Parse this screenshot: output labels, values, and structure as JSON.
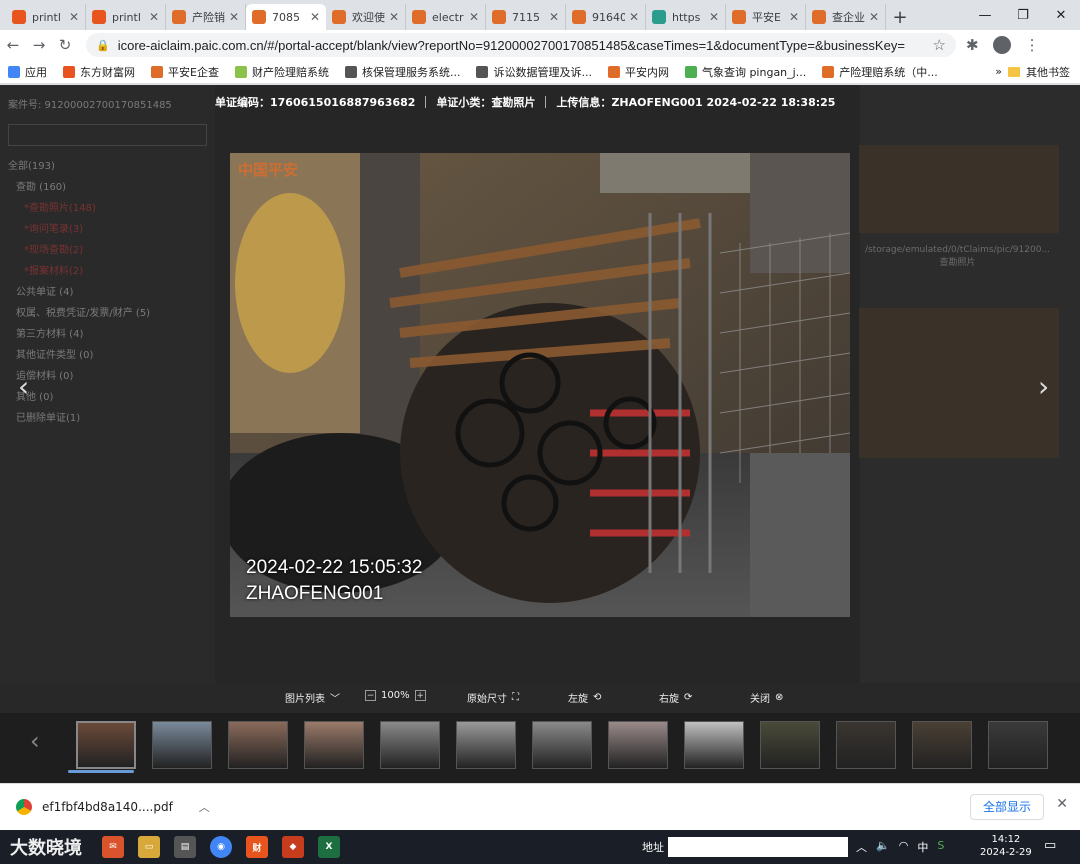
{
  "browser": {
    "tabs": [
      {
        "label": "printl",
        "color": "#e8541e",
        "active": false
      },
      {
        "label": "printl",
        "color": "#e8541e",
        "active": false
      },
      {
        "label": "产险销",
        "color": "#e06c2a",
        "active": false
      },
      {
        "label": "7085",
        "color": "#e06c2a",
        "active": true
      },
      {
        "label": "欢迎使",
        "color": "#e06c2a",
        "active": false
      },
      {
        "label": "electr",
        "color": "#e06c2a",
        "active": false
      },
      {
        "label": "7115",
        "color": "#e06c2a",
        "active": false
      },
      {
        "label": "91640",
        "color": "#e06c2a",
        "active": false
      },
      {
        "label": "https",
        "color": "#2a9d8f",
        "active": false
      },
      {
        "label": "平安E",
        "color": "#e06c2a",
        "active": false
      },
      {
        "label": "查企业",
        "color": "#e06c2a",
        "active": false
      }
    ],
    "url": "icore-aiclaim.paic.com.cn/#/portal-accept/blank/view?reportNo=91200002700170851485&caseTimes=1&documentType=&businessKey=",
    "bookmarks": [
      {
        "label": "应用",
        "color": "#4285f4"
      },
      {
        "label": "东方财富网",
        "color": "#e8541e"
      },
      {
        "label": "平安E企查",
        "color": "#e06c2a"
      },
      {
        "label": "财产险理赔系统",
        "color": "#8bc34a"
      },
      {
        "label": "核保管理服务系统...",
        "color": "#555555"
      },
      {
        "label": "诉讼数据管理及诉...",
        "color": "#555555"
      },
      {
        "label": "平安内网",
        "color": "#e06c2a"
      },
      {
        "label": "气象查询 pingan_j...",
        "color": "#4caf50"
      },
      {
        "label": "产险理赔系统（中...",
        "color": "#e06c2a"
      }
    ],
    "bookmark_more": "»",
    "bookmark_other": "其他书签"
  },
  "viewer": {
    "voucher_label": "单证编码：",
    "voucher_code": "1760615016887963682",
    "type_label": "单证小类：",
    "type_value": "查勘照片",
    "upload_label": "上传信息：",
    "upload_value": "ZHAOFENG001 2024-02-22 18:38:25",
    "overlay_date": "2024-02-22 15:05:32",
    "overlay_user": "ZHAOFENG001",
    "controls": {
      "list": "图片列表",
      "zoom": "100%",
      "original": "原始尺寸",
      "rotate_left": "左旋",
      "rotate_right": "右旋",
      "close": "关闭"
    }
  },
  "background": {
    "case_label": "案件号: 91200002700170851485",
    "all_label": "全部(193)",
    "items": [
      "查勘 (160)",
      "*查勘照片(148)",
      "*询问笔录(3)",
      "*现场查勘(2)",
      "*报案材料(2)",
      "公共单证 (4)",
      "权属、税费凭证/发票/财产 (5)",
      "第三方材料 (4)",
      "其他证件类型 (0)",
      "追偿材料 (0)",
      "其他 (0)",
      "已删除单证(1)"
    ],
    "right_path": "/storage/emulated/0/tClaims/pic/91200...",
    "right_caption": "查勘照片"
  },
  "download": {
    "filename": "ef1fbf4bd8a140....pdf",
    "show_all": "全部显示"
  },
  "taskbar": {
    "logo_text": "大数晓境",
    "address_label": "地址",
    "time": "14:12",
    "date": "2024-2-29",
    "tray_text": "中"
  }
}
